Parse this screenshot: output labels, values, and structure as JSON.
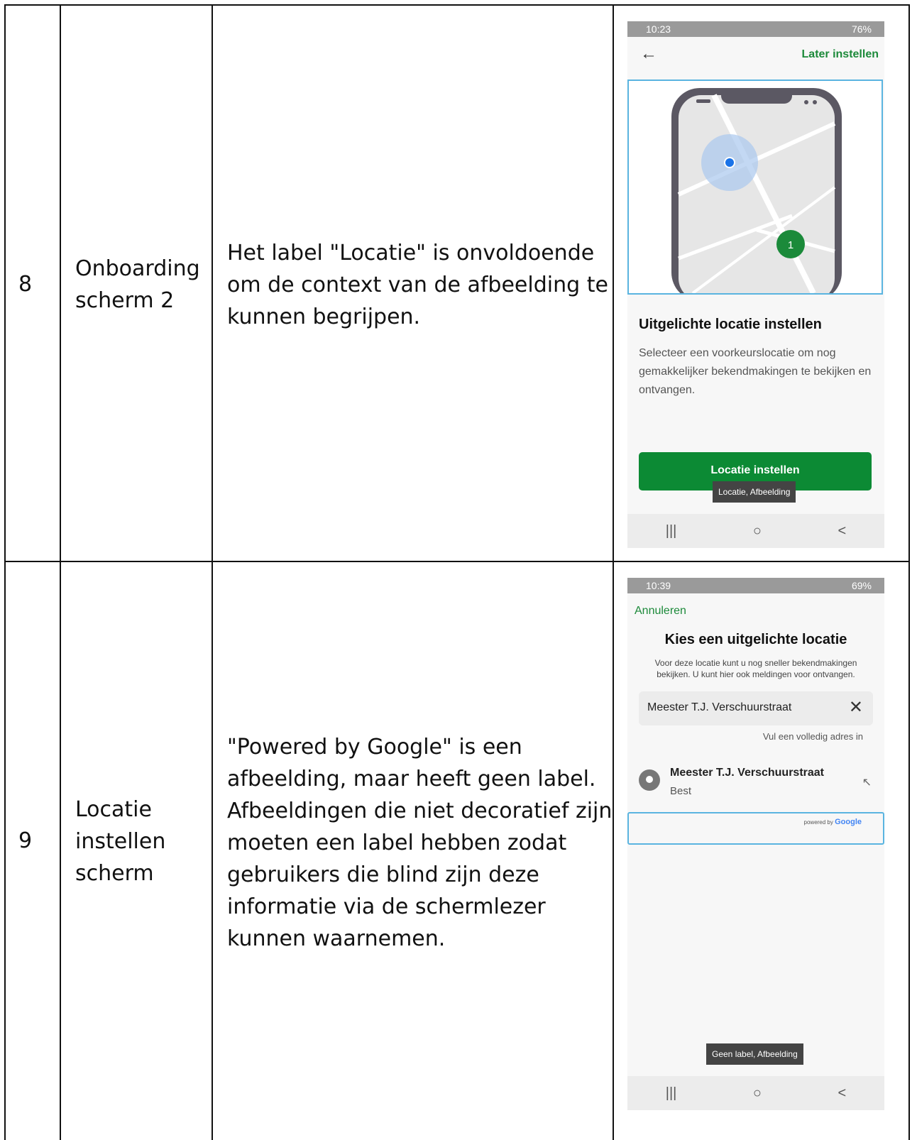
{
  "rows": [
    {
      "number": "8",
      "name_line1": "Onboarding",
      "name_line2": "scherm 2",
      "description_lines": [
        "Het label \"Locatie\" is onvoldoende",
        "om de context van de afbeelding te",
        "kunnen begrijpen."
      ],
      "screen": {
        "status_time": "10:23",
        "status_right": "76%",
        "back_icon": "back-arrow-icon",
        "later_label": "Later instellen",
        "map_marker_label": "1",
        "title": "Uitgelichte locatie instellen",
        "description": "Selecteer een voorkeurslocatie om nog gemakkelijker bekendmakingen te bekijken en ontvangen.",
        "button_label": "Locatie instellen",
        "tooltip": "Locatie, Afbeelding"
      }
    },
    {
      "number": "9",
      "name_line1": "Locatie",
      "name_line2": "instellen",
      "name_line3": "scherm",
      "description_lines": [
        "\"Powered by Google\" is een",
        "afbeelding, maar heeft geen label.",
        "Afbeeldingen die niet decoratief zijn",
        "moeten een label hebben zodat",
        "gebruikers die blind zijn deze",
        "informatie via de schermlezer",
        "kunnen waarnemen."
      ],
      "screen": {
        "status_time": "10:39",
        "status_right": "69%",
        "cancel_label": "Annuleren",
        "title": "Kies een uitgelichte locatie",
        "description": "Voor deze locatie kunt u nog sneller bekendmakingen bekijken. U kunt hier ook meldingen voor ontvangen.",
        "input_value": "Meester T.J. Verschuurstraat",
        "hint": "Vul een volledig adres in",
        "result_street": "Meester T.J. Verschuurstraat",
        "result_city": "Best",
        "powered_by": "powered by",
        "powered_brand": "Google",
        "tooltip": "Geen label, Afbeelding"
      }
    }
  ],
  "navbar": {
    "recent": "|||",
    "home": "○",
    "back": "<"
  }
}
